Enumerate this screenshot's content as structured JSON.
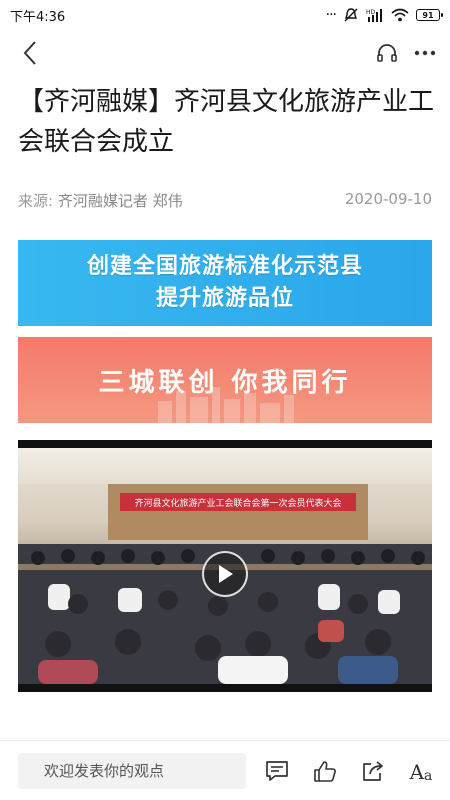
{
  "status_bar": {
    "time": "下午4:36",
    "battery": "91",
    "network_label": "HD"
  },
  "nav": {
    "back_icon": "chevron-left-icon",
    "listen_icon": "headphones-icon",
    "more_icon": "more-icon"
  },
  "article": {
    "title": "【齐河融媒】齐河县文化旅游产业工会联合会成立",
    "source_label": "来源:",
    "source_name": "齐河融媒记者 郑伟",
    "date": "2020-09-10"
  },
  "banners": {
    "blue_line1": "创建全国旅游标准化示范县",
    "blue_line2": "提升旅游品位",
    "red_line": "三城联创 你我同行",
    "blue_color": "#2aa6ea",
    "red_color": "#f57a6b"
  },
  "video": {
    "stage_text": "齐河县文化旅游产业工会联合会第一次会员代表大会",
    "play_icon": "play-icon"
  },
  "bottom_bar": {
    "comment_placeholder": "欢迎发表你的观点",
    "comment_icon": "comment-icon",
    "like_icon": "thumbs-up-icon",
    "share_icon": "share-icon",
    "font_big": "A",
    "font_small": "a"
  }
}
